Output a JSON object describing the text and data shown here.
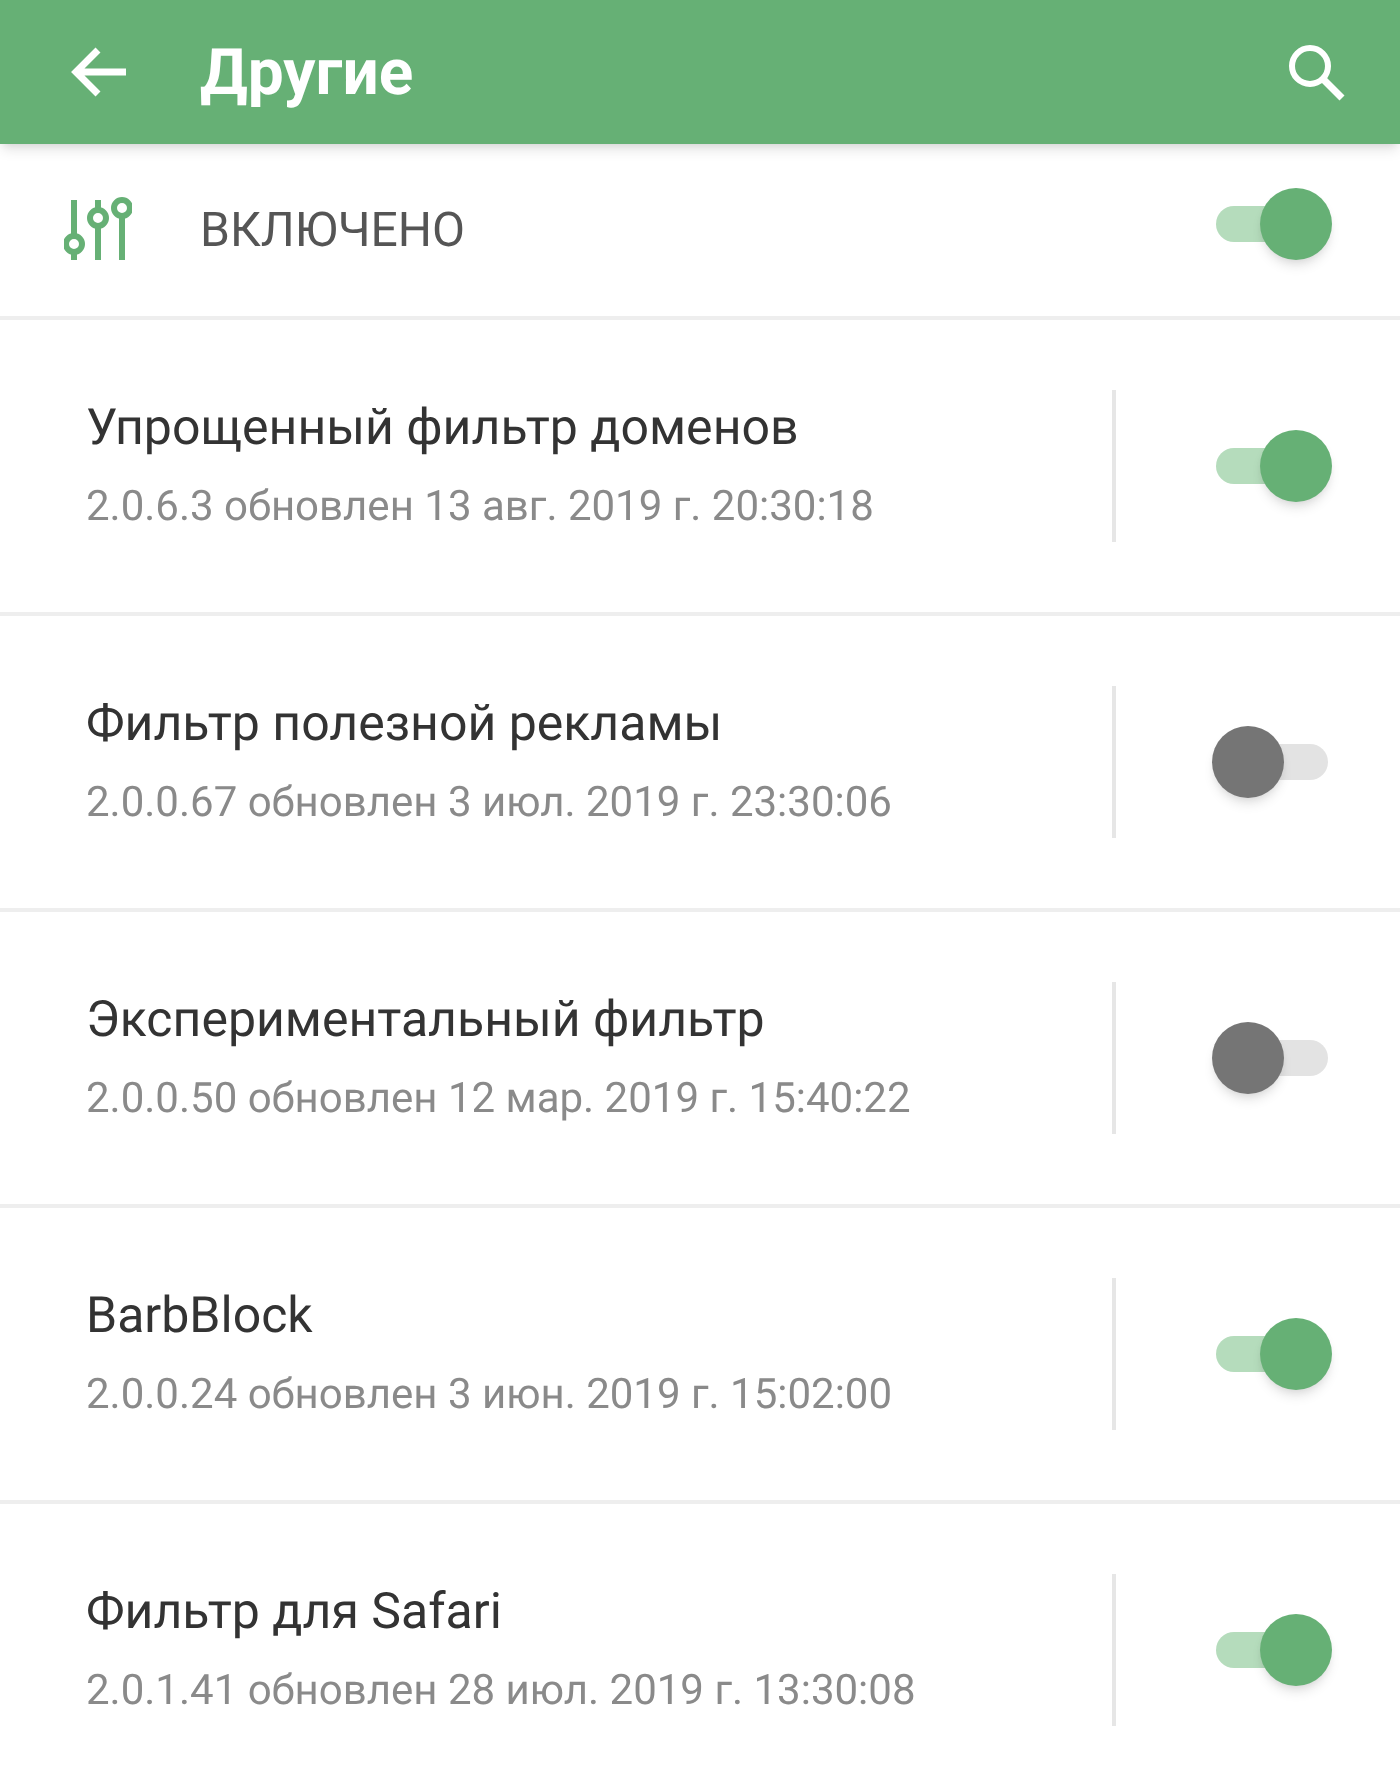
{
  "app_bar": {
    "title": "Другие"
  },
  "master": {
    "label": "ВКЛЮЧЕНО",
    "on": true
  },
  "filters": [
    {
      "name": "Упрощенный фильтр доменов",
      "info": "2.0.6.3 обновлен 13 авг. 2019 г. 20:30:18",
      "on": true
    },
    {
      "name": "Фильтр полезной рекламы",
      "info": "2.0.0.67 обновлен 3 июл. 2019 г. 23:30:06",
      "on": false
    },
    {
      "name": "Экспериментальный фильтр",
      "info": "2.0.0.50 обновлен 12 мар. 2019 г. 15:40:22",
      "on": false
    },
    {
      "name": "BarbBlock",
      "info": "2.0.0.24 обновлен 3 июн. 2019 г. 15:02:00",
      "on": true
    },
    {
      "name": "Фильтр для Safari",
      "info": "2.0.1.41 обновлен 28 июл. 2019 г. 13:30:08",
      "on": true
    }
  ]
}
